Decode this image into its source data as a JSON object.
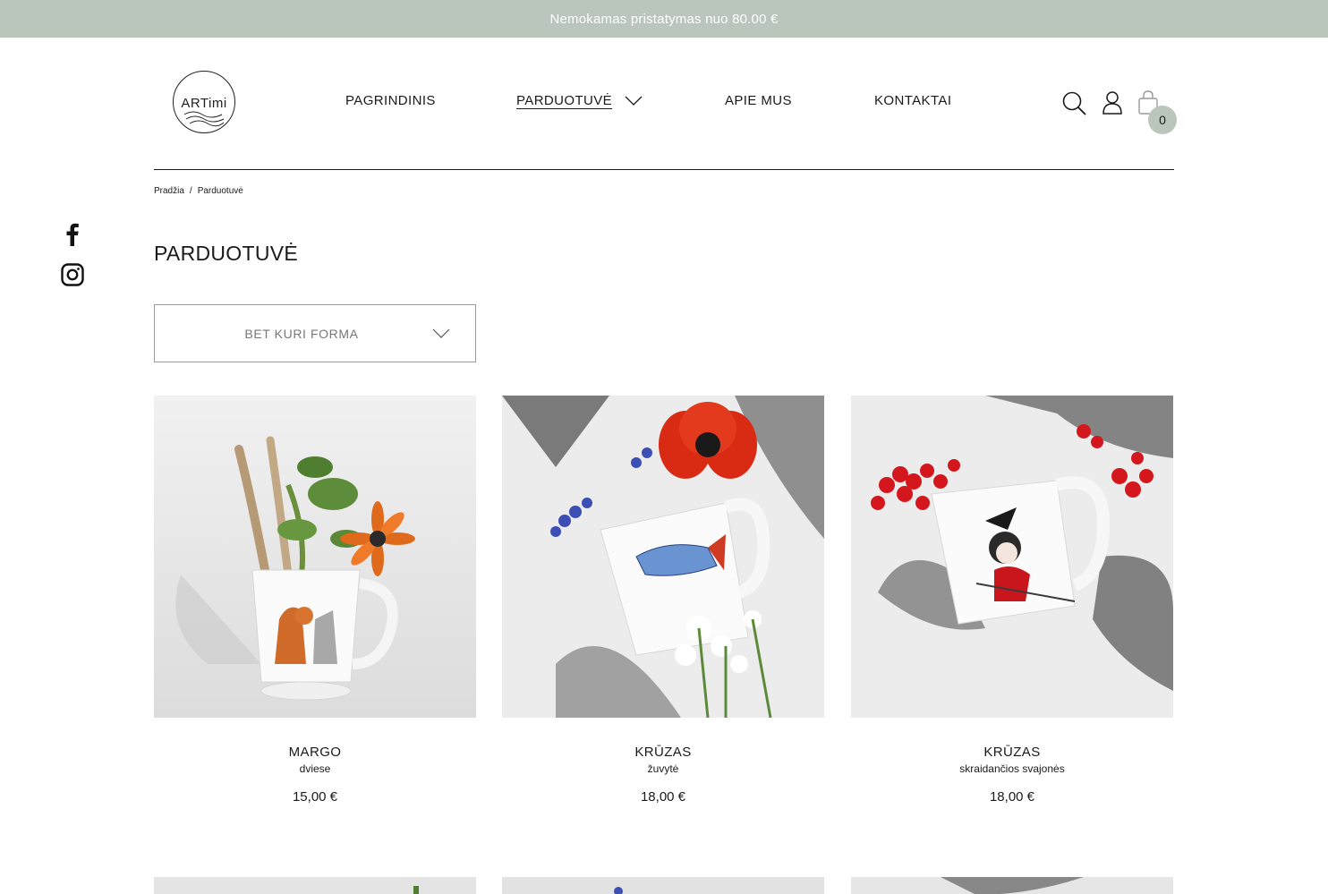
{
  "promo": {
    "text": "Nemokamas pristatymas nuo 80.00 €"
  },
  "logo": {
    "text": "ARTimi"
  },
  "nav": {
    "items": [
      {
        "label": "PAGRINDINIS"
      },
      {
        "label": "PARDUOTUVĖ"
      },
      {
        "label": "APIE MUS"
      },
      {
        "label": "KONTAKTAI"
      }
    ]
  },
  "header_icons": {
    "search": "search-icon",
    "account": "user-icon",
    "cart": "bag-icon",
    "cart_count": "0"
  },
  "breadcrumb": {
    "home": "Pradžia",
    "separator": "/",
    "current": "Parduotuvė"
  },
  "social": {
    "facebook": "facebook-icon",
    "instagram": "instagram-icon"
  },
  "page": {
    "title": "PARDUOTUVĖ"
  },
  "filter": {
    "label": "BET KURI FORMA"
  },
  "products": [
    {
      "name": "MARGO",
      "subtitle": "dviese",
      "price": "15,00 €"
    },
    {
      "name": "KRŪZAS",
      "subtitle": "žuvytė",
      "price": "18,00 €"
    },
    {
      "name": "KRŪZAS",
      "subtitle": "skraidančios svajonės",
      "price": "18,00 €"
    }
  ],
  "colors": {
    "accent": "#bac5bb",
    "text": "#1a1a1a",
    "border": "#9a9a9a"
  }
}
